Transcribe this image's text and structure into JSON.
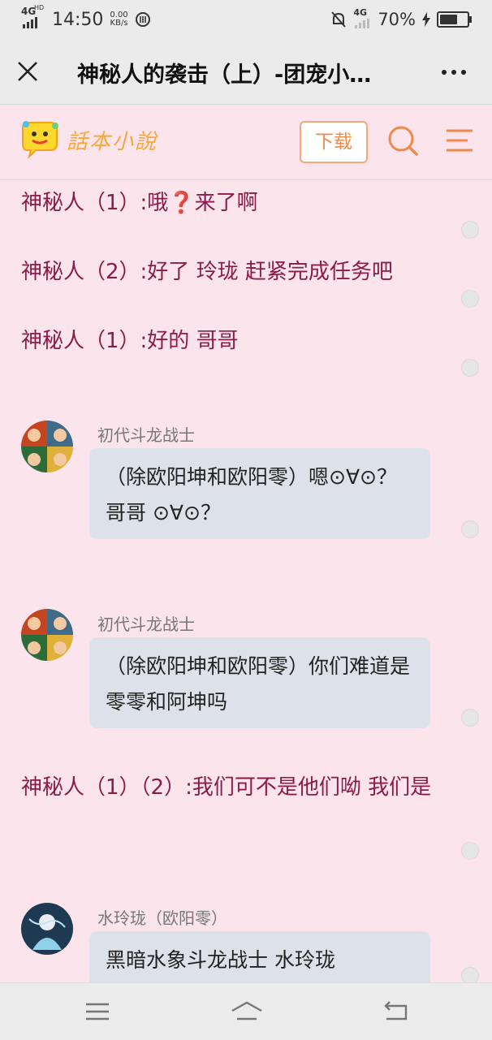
{
  "status": {
    "time": "14:50",
    "network_left": "4G",
    "network_left_sup": "HD",
    "speed_value": "0.00",
    "speed_unit": "KB/s",
    "network_right": "4G",
    "battery": "70%",
    "battery_level": 0.7
  },
  "titlebar": {
    "title": "神秘人的袭击（上）-团宠小…"
  },
  "site": {
    "logo_text": "話本小說",
    "download_label": "下载"
  },
  "story": {
    "lines": [
      "神秘人（1）:哦❓来了啊",
      "神秘人（2）:好了 玲珑 赶紧完成任务吧",
      "神秘人（1）:好的 哥哥"
    ],
    "msg1": {
      "name": "初代斗龙战士",
      "text": "（除欧阳坤和欧阳零）嗯⊙∀⊙？  哥哥 ⊙∀⊙？"
    },
    "msg2": {
      "name": "初代斗龙战士",
      "text": "（除欧阳坤和欧阳零）你们难道是零零和阿坤吗"
    },
    "line4": "神秘人（1）（2）:我们可不是他们呦 我们是",
    "msg3": {
      "name": "水玲珑（欧阳零）",
      "text": "黑暗水象斗龙战士 水玲珑"
    }
  },
  "colors": {
    "narration": "#8a1c4a",
    "background": "#fbe4ec",
    "accent": "#f08a4b",
    "logo": "#f6a83b"
  }
}
